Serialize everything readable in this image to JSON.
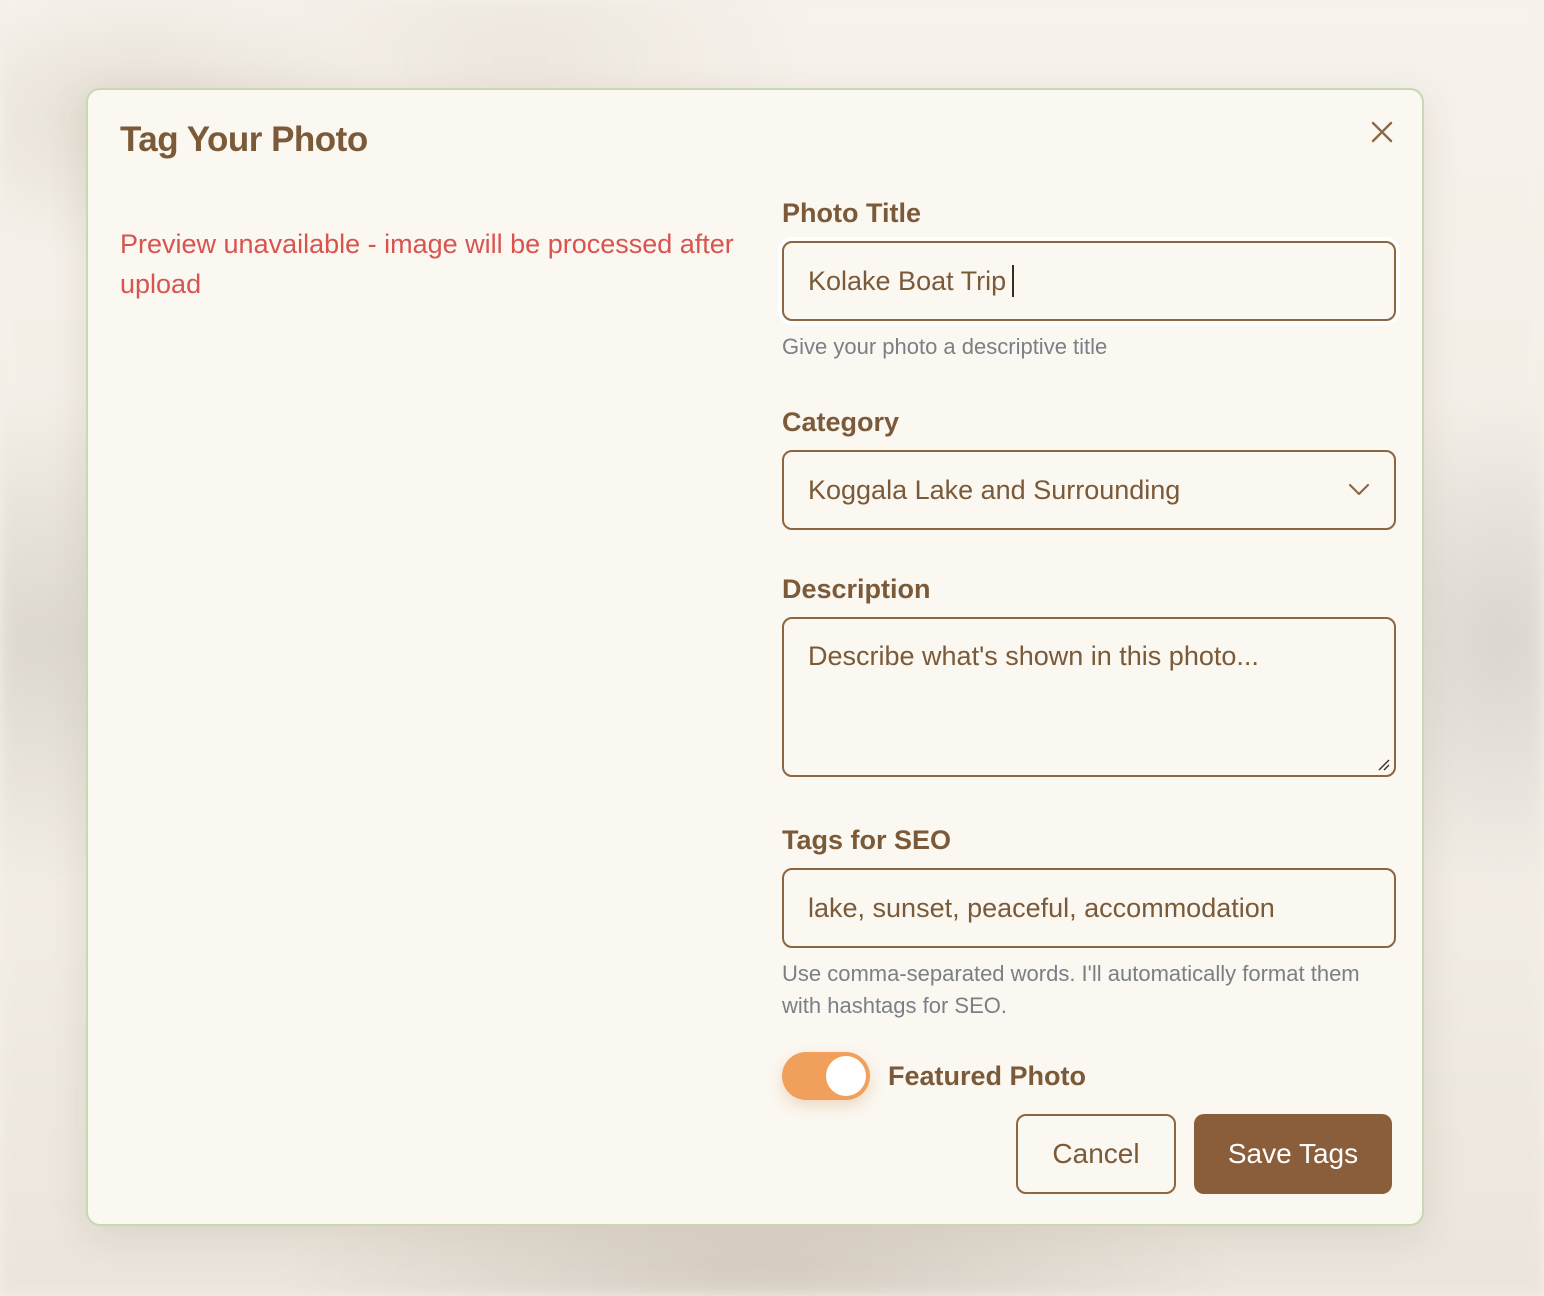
{
  "dialog": {
    "title": "Tag Your Photo",
    "close_icon": "close-icon"
  },
  "preview": {
    "message": "Preview unavailable - image will be processed after upload"
  },
  "form": {
    "title": {
      "label": "Photo Title",
      "value": "Kolake Boat Trip",
      "help": "Give your photo a descriptive title"
    },
    "category": {
      "label": "Category",
      "selected": "Koggala Lake and Surrounding",
      "icon": "chevron-down-icon"
    },
    "description": {
      "label": "Description",
      "placeholder": "Describe what's shown in this photo..."
    },
    "tags": {
      "label": "Tags for SEO",
      "value": "lake, sunset, peaceful, accommodation",
      "help": "Use comma-separated words. I'll automatically format them with hashtags for SEO."
    },
    "featured": {
      "label": "Featured Photo",
      "on": true
    }
  },
  "actions": {
    "cancel_label": "Cancel",
    "save_label": "Save Tags"
  },
  "colors": {
    "accent_brown": "#8b5e3b",
    "error_red": "#d9534f",
    "toggle_orange": "#f0a05a"
  }
}
